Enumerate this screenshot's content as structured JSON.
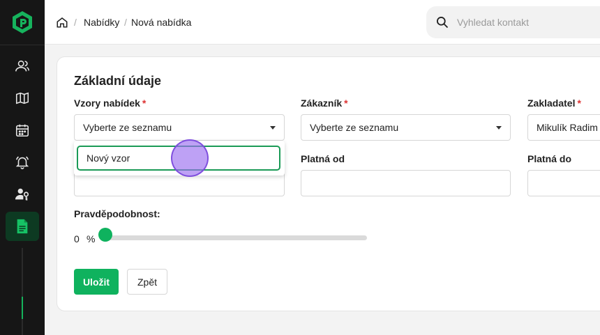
{
  "header": {
    "breadcrumb": [
      "Nabídky",
      "Nová nabídka"
    ],
    "breadcrumb_sep": "/",
    "search_placeholder": "Vyhledat kontakt"
  },
  "sidebar": {
    "icons": [
      "logo-icon",
      "contacts-icon",
      "map-icon",
      "calendar-icon",
      "bell-icon",
      "user-key-icon",
      "document-icon"
    ],
    "active_item": "document-icon",
    "accent": "#15b35c"
  },
  "form": {
    "title": "Základní údaje",
    "required_mark": "*",
    "templates_label": "Vzory nabídek",
    "templates_value": "Vyberte ze seznamu",
    "templates_option": "Nový vzor",
    "customer_label": "Zákazník",
    "customer_value": "Vyberte ze seznamu",
    "founder_label": "Zakladatel",
    "founder_value": "Mikulík Radim",
    "valid_from_label": "Platná od",
    "valid_from_value": "",
    "valid_to_label": "Platná do",
    "valid_to_value": "",
    "probability_label": "Pravděpodobnost:",
    "probability_value": "0",
    "probability_unit": "%",
    "save_label": "Uložit",
    "back_label": "Zpět"
  },
  "colors": {
    "primary": "#0fb25e",
    "sidebar_bg": "#161616",
    "active_bg": "#0d3a22"
  }
}
